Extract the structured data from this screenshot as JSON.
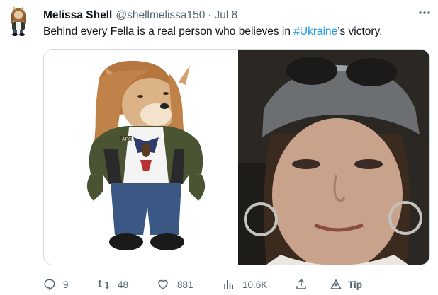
{
  "author": {
    "display_name": "Melissa Shell",
    "handle": "@shellmelissa150",
    "separator": "·",
    "date": "Jul 8"
  },
  "tweet": {
    "text_before": "Behind every Fella is a real person who believes in ",
    "hashtag": "#Ukraine",
    "text_after": "’s victory."
  },
  "media": {
    "left_image": "cartoon-shiba-dog-with-long-hair-meme",
    "right_image": "selfie-woman-with-cap-and-hoop-earrings",
    "left_badge_text": "AFO"
  },
  "actions": {
    "replies": "9",
    "retweets": "48",
    "likes": "881",
    "views": "10.6K",
    "tip_label": "Tip"
  },
  "colors": {
    "text": "#0f1419",
    "secondary": "#536471",
    "link": "#1d9bf0",
    "border": "#cfd9de"
  },
  "icons": [
    "more-icon",
    "reply-icon",
    "retweet-icon",
    "like-icon",
    "views-icon",
    "share-icon",
    "tip-icon"
  ]
}
